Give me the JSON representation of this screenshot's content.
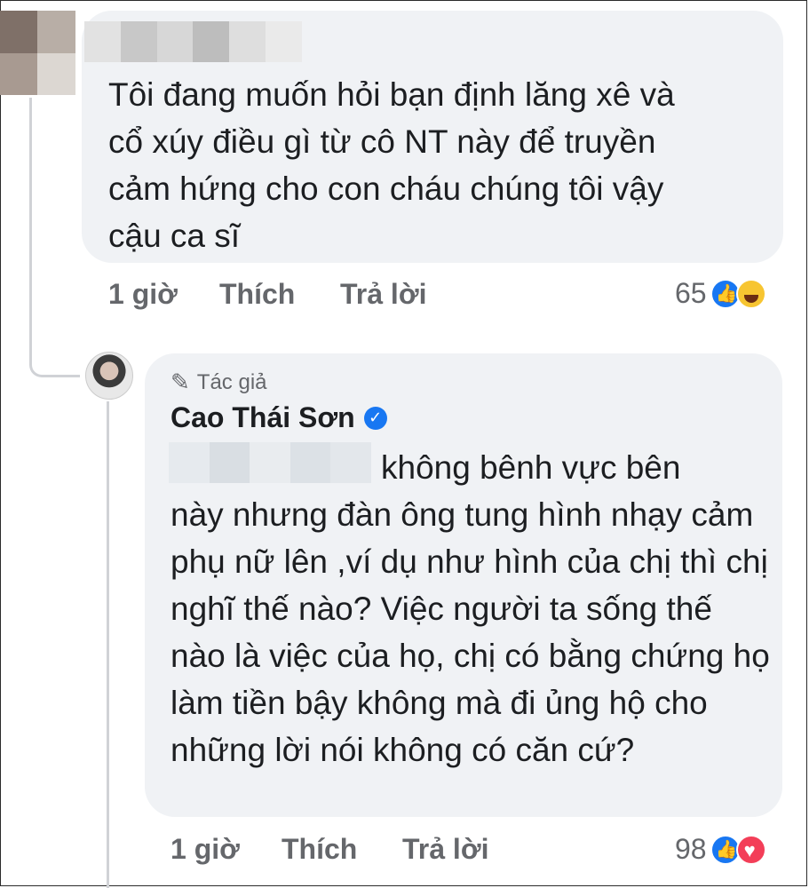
{
  "comment": {
    "text": "Tôi đang muốn hỏi bạn định lăng xê và\ncổ xúy  điều gì từ cô NT này để truyền\ncảm hứng cho  con cháu chúng tôi vậy\ncậu  ca sĩ",
    "time": "1 giờ",
    "like_label": "Thích",
    "reply_label": "Trả lời",
    "reaction_count": "65",
    "reactions": [
      "like-icon",
      "haha-icon"
    ]
  },
  "reply": {
    "badge_label": "Tác giả",
    "author": "Cao Thái Sơn",
    "text_first": "không bênh vực bên",
    "text_rest": "này nhưng đàn ông tung hình nhạy cảm phụ nữ lên ,ví dụ như hình của chị thì chị nghĩ thế nào? Việc người ta sống thế nào là việc của họ, chị có bằng chứng họ làm tiền bậy không mà đi ủng hộ cho những lời nói không có căn cứ?",
    "time": "1 giờ",
    "like_label": "Thích",
    "reply_label": "Trả lời",
    "reaction_count": "98",
    "reactions": [
      "like-icon",
      "love-icon"
    ]
  },
  "colors": {
    "bubble": "#f0f2f5",
    "meta": "#65676b",
    "text": "#1c1e21",
    "accent": "#1877f2"
  }
}
